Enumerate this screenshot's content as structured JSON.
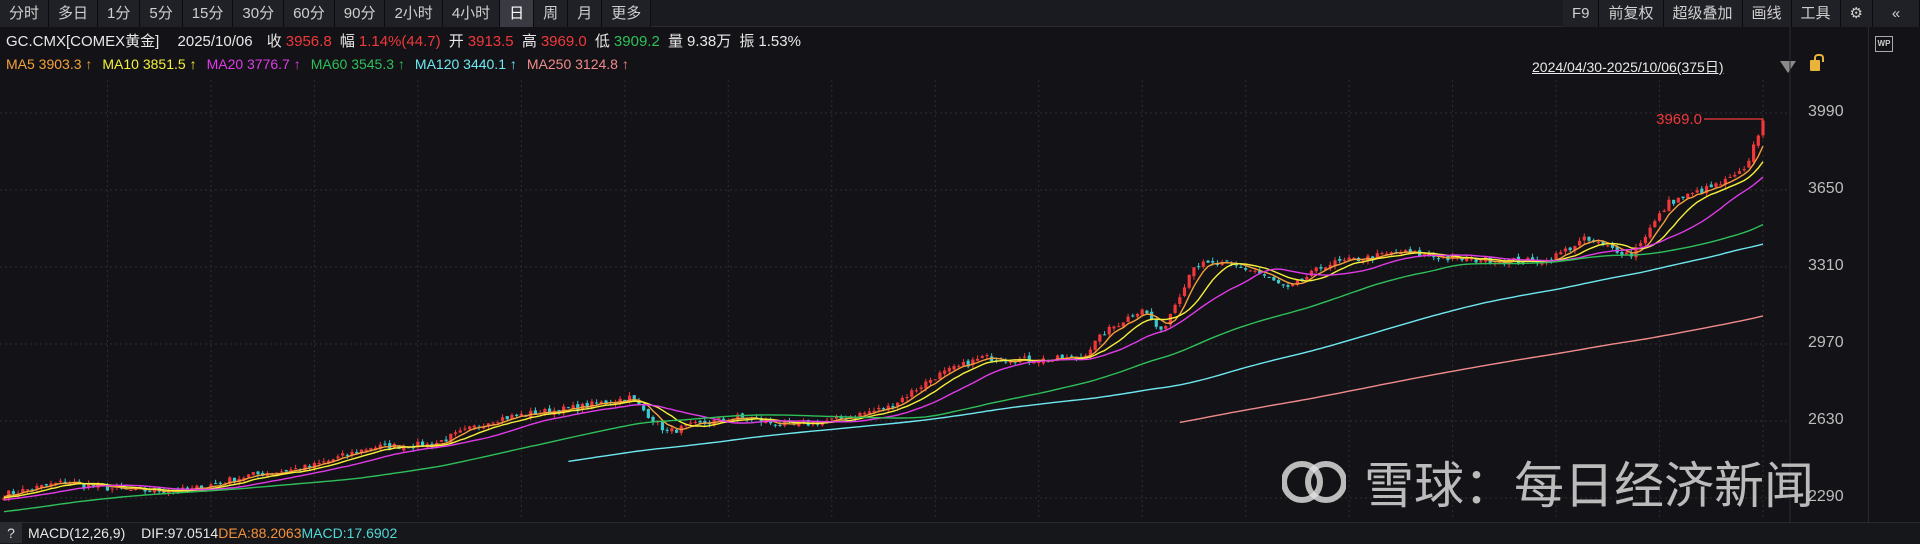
{
  "toolbar": {
    "periods": [
      "分时",
      "多日",
      "1分",
      "5分",
      "15分",
      "30分",
      "60分",
      "90分",
      "2小时",
      "4小时",
      "日",
      "周",
      "月",
      "更多"
    ],
    "active": "日",
    "right": [
      "F9",
      "前复权",
      "超级叠加",
      "画线",
      "工具"
    ],
    "settings_icon": "gear-icon",
    "collapse_icon": "double-chevron-left-icon"
  },
  "quote": {
    "symbol": "GC.CMX[COMEX黄金]",
    "date": "2025/10/06",
    "close_label": "收",
    "close": "3956.8",
    "change_label": "幅",
    "change": "1.14%(44.7)",
    "open_label": "开",
    "open": "3913.5",
    "high_label": "高",
    "high": "3969.0",
    "low_label": "低",
    "low": "3909.2",
    "volume_label": "量",
    "volume": "9.38万",
    "amplitude_label": "振",
    "amplitude": "1.53%"
  },
  "ma": [
    {
      "label": "MA5 3903.3 ↑",
      "color": "#f5a03a"
    },
    {
      "label": "MA10 3851.5 ↑",
      "color": "#f5f03a"
    },
    {
      "label": "MA20 3776.7 ↑",
      "color": "#e03ae8"
    },
    {
      "label": "MA60 3545.3 ↑",
      "color": "#2fbf5a"
    },
    {
      "label": "MA120 3440.1 ↑",
      "color": "#6ee8f0"
    },
    {
      "label": "MA250 3124.8 ↑",
      "color": "#f08a8a"
    }
  ],
  "range": {
    "label": "2024/04/30-2025/10/06(375日)"
  },
  "wp_label": "WP",
  "high_marker": "3969.0",
  "macd": {
    "help": "?",
    "title": "MACD(12,26,9)",
    "dif": "DIF:97.0514",
    "dea": "DEA:88.2063",
    "macd": "MACD:17.6902"
  },
  "watermark": "雪球：每日经济新闻",
  "colors": {
    "up": "#f0383b",
    "down": "#3cc8cc"
  },
  "chart_data": {
    "type": "candlestick",
    "count": 375,
    "y_ticks": [
      3990,
      3650,
      3310,
      2970,
      2630,
      2290
    ],
    "ylim": [
      2250,
      4080
    ],
    "close_path": [
      [
        0,
        2306
      ],
      [
        13,
        2361
      ],
      [
        26,
        2323
      ],
      [
        39,
        2323
      ],
      [
        52,
        2389
      ],
      [
        65,
        2427
      ],
      [
        78,
        2515
      ],
      [
        91,
        2526
      ],
      [
        104,
        2636
      ],
      [
        112,
        2663
      ],
      [
        122,
        2690
      ],
      [
        133,
        2734
      ],
      [
        141,
        2581
      ],
      [
        146,
        2608
      ],
      [
        156,
        2647
      ],
      [
        167,
        2608
      ],
      [
        177,
        2636
      ],
      [
        188,
        2690
      ],
      [
        198,
        2827
      ],
      [
        208,
        2910
      ],
      [
        219,
        2899
      ],
      [
        229,
        2910
      ],
      [
        234,
        3019
      ],
      [
        242,
        3129
      ],
      [
        246,
        3019
      ],
      [
        253,
        3321
      ],
      [
        260,
        3321
      ],
      [
        266,
        3293
      ],
      [
        273,
        3211
      ],
      [
        281,
        3321
      ],
      [
        289,
        3348
      ],
      [
        297,
        3376
      ],
      [
        307,
        3348
      ],
      [
        318,
        3337
      ],
      [
        328,
        3337
      ],
      [
        336,
        3431
      ],
      [
        346,
        3365
      ],
      [
        354,
        3595
      ],
      [
        365,
        3677
      ],
      [
        370,
        3732
      ],
      [
        374,
        3956.8
      ]
    ]
  }
}
